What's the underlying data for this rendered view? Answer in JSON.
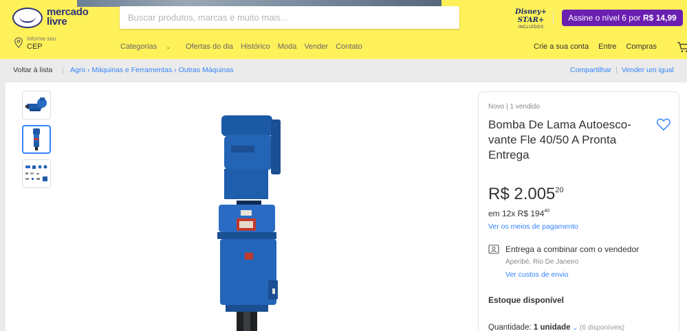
{
  "header": {
    "logo_line1": "mercado",
    "logo_line2": "livre",
    "search_placeholder": "Buscar produtos, marcas e muito mais…",
    "search_icon": "search-icon",
    "disney_logo": "Disney+ STAR+",
    "disney_sub": "INCLUÍDOS",
    "promo_text": "Assine o nível 6 por",
    "promo_price": "R$ 14,99",
    "location_small": "Informe seu",
    "location_main": "CEP",
    "nav": [
      "Categorias",
      "Ofertas do dia",
      "Histórico",
      "Moda",
      "Vender",
      "Contato"
    ],
    "user_nav": [
      "Crie a sua conta",
      "Entre",
      "Compras"
    ],
    "accent": "#fff159"
  },
  "breadcrumb": {
    "back": "Voltar à lista",
    "path": [
      "Agro",
      "Máquinas e Ferramentas",
      "Outras Máquinas"
    ],
    "share": "Compartilhar",
    "sell": "Vender um igual"
  },
  "gallery": {
    "thumbnails": [
      "pump-side-view",
      "pump-front-view",
      "pump-parts-sheet"
    ],
    "active_index": 1
  },
  "product": {
    "condition": "Novo  |  1 vendido",
    "title": "Bomba De Lama Autoesco- vante Fle 40/50 A Pronta Entrega",
    "price_integer": "R$ 2.005",
    "price_cents": "20",
    "installments_prefix": "em 12x R$ 194",
    "installments_cents": "40",
    "payment_link": "Ver os meios de pagamento",
    "delivery": "Entrega a combinar com o vendedor",
    "delivery_location": "Aperibé, Rio De Janeiro",
    "shipping_link": "Ver custos de envio",
    "stock": "Estoque disponível",
    "quantity_label": "Quantidade:",
    "quantity_value": "1 unidade",
    "quantity_available": "(6 disponíveis)",
    "link_color": "#3483fa"
  }
}
